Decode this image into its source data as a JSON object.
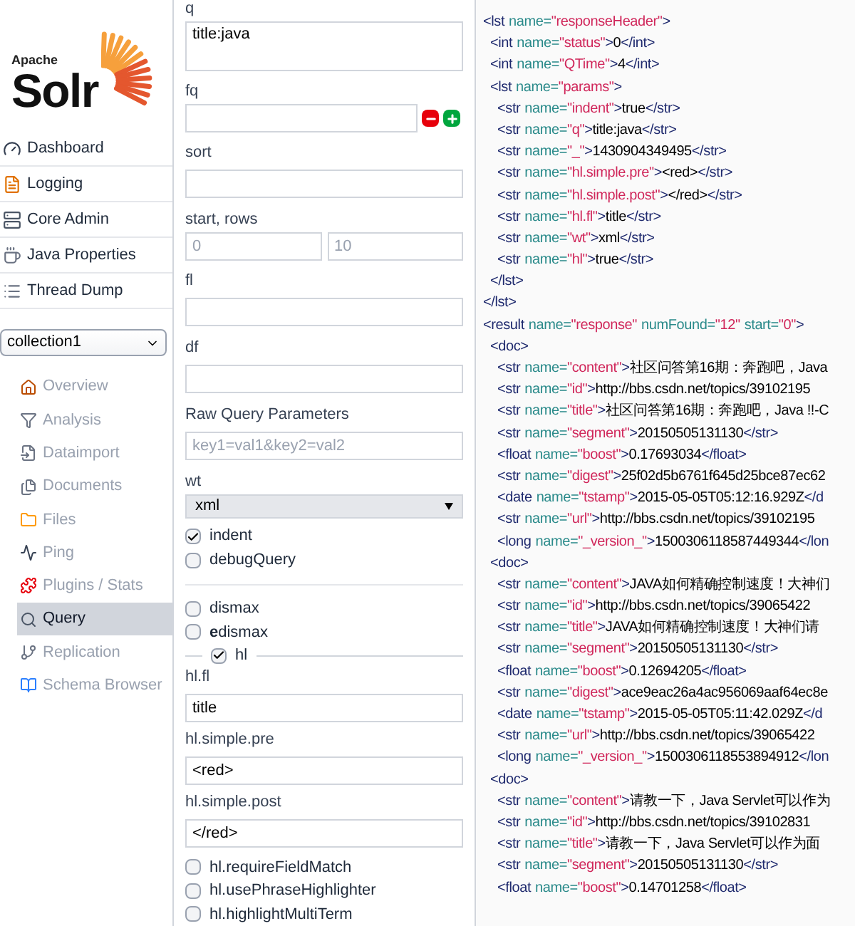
{
  "logo": {
    "small": "Apache",
    "big": "Solr"
  },
  "nav": [
    {
      "label": "Dashboard"
    },
    {
      "label": "Logging"
    },
    {
      "label": "Core Admin"
    },
    {
      "label": "Java Properties"
    },
    {
      "label": "Thread Dump"
    }
  ],
  "core_select": {
    "value": "collection1"
  },
  "core_menu": [
    {
      "label": "Overview",
      "selected": false
    },
    {
      "label": "Analysis",
      "selected": false
    },
    {
      "label": "Dataimport",
      "selected": false
    },
    {
      "label": "Documents",
      "selected": false
    },
    {
      "label": "Files",
      "selected": false
    },
    {
      "label": "Ping",
      "selected": false
    },
    {
      "label": "Plugins / Stats",
      "selected": false
    },
    {
      "label": "Query",
      "selected": true
    },
    {
      "label": "Replication",
      "selected": false
    },
    {
      "label": "Schema Browser",
      "selected": false
    }
  ],
  "form": [
    {
      "kind": "textarea",
      "label": "q",
      "value": "title:java"
    },
    {
      "kind": "filter",
      "label": "fq"
    },
    {
      "kind": "text",
      "label": "sort"
    },
    {
      "kind": "pair",
      "label": "start, rows",
      "placeholders": [
        "0",
        "10"
      ]
    },
    {
      "kind": "text",
      "label": "fl"
    },
    {
      "kind": "text",
      "label": "df"
    },
    {
      "kind": "text",
      "label": "Raw Query Parameters",
      "placeholder": "key1=val1&key2=val2"
    },
    {
      "kind": "select",
      "label": "wt",
      "value": "xml"
    },
    {
      "kind": "checkbox",
      "label": "indent",
      "checked": true
    },
    {
      "kind": "checkbox",
      "label": "debugQuery",
      "checked": false
    }
  ],
  "def_types": [
    {
      "label": "dismax",
      "checked": false
    },
    {
      "label": "**e**dismax",
      "checked": false
    }
  ],
  "hl": {
    "label": "hl",
    "checked": true,
    "fields": [
      {
        "label": "hl.fl",
        "value": "title"
      },
      {
        "label": "hl.simple.pre",
        "value": "<red>"
      },
      {
        "label": "hl.simple.post",
        "value": "</red>"
      }
    ],
    "options": [
      {
        "label": "hl.requireFieldMatch",
        "checked": false
      },
      {
        "label": "hl.usePhraseHighlighter",
        "checked": false
      },
      {
        "label": "hl.highlightMultiTerm",
        "checked": false
      }
    ]
  },
  "response": [
    {
      "parts": [
        {
          "kind": "tag",
          "text": "<lst"
        },
        {
          "kind": "attr",
          "text": "name="
        },
        {
          "kind": "value",
          "text": "\"responseHeader\""
        },
        {
          "kind": "tag",
          "text": ">"
        }
      ],
      "children": [
        {
          "parts": [
            {
              "kind": "tag",
              "text": "<int"
            },
            {
              "kind": "attr",
              "text": "name="
            },
            {
              "kind": "value",
              "text": "\"status\""
            },
            {
              "kind": "tag",
              "text": ">"
            },
            {
              "kind": "text",
              "text": "0"
            },
            {
              "kind": "tag",
              "text": "</int>"
            }
          ]
        },
        {
          "parts": [
            {
              "kind": "tag",
              "text": "<int"
            },
            {
              "kind": "attr",
              "text": "name="
            },
            {
              "kind": "value",
              "text": "\"QTime\""
            },
            {
              "kind": "tag",
              "text": ">"
            },
            {
              "kind": "text",
              "text": "4"
            },
            {
              "kind": "tag",
              "text": "</int>"
            }
          ]
        },
        {
          "parts": [
            {
              "kind": "tag",
              "text": "<lst"
            },
            {
              "kind": "attr",
              "text": "name="
            },
            {
              "kind": "value",
              "text": "\"params\""
            },
            {
              "kind": "tag",
              "text": ">"
            }
          ],
          "children": [
            {
              "parts": [
                {
                  "kind": "tag",
                  "text": "<str"
                },
                {
                  "kind": "attr",
                  "text": "name="
                },
                {
                  "kind": "value",
                  "text": "\"indent\""
                },
                {
                  "kind": "tag",
                  "text": ">"
                },
                {
                  "kind": "text",
                  "text": "true"
                },
                {
                  "kind": "tag",
                  "text": "</str>"
                }
              ]
            },
            {
              "parts": [
                {
                  "kind": "tag",
                  "text": "<str"
                },
                {
                  "kind": "attr",
                  "text": "name="
                },
                {
                  "kind": "value",
                  "text": "\"q\""
                },
                {
                  "kind": "tag",
                  "text": ">"
                },
                {
                  "kind": "text",
                  "text": "title:java"
                },
                {
                  "kind": "tag",
                  "text": "</str>"
                }
              ]
            },
            {
              "parts": [
                {
                  "kind": "tag",
                  "text": "<str"
                },
                {
                  "kind": "attr",
                  "text": "name="
                },
                {
                  "kind": "value",
                  "text": "\"_\""
                },
                {
                  "kind": "tag",
                  "text": ">"
                },
                {
                  "kind": "text",
                  "text": "1430904349495"
                },
                {
                  "kind": "tag",
                  "text": "</str>"
                }
              ]
            },
            {
              "parts": [
                {
                  "kind": "tag",
                  "text": "<str"
                },
                {
                  "kind": "attr",
                  "text": "name="
                },
                {
                  "kind": "value",
                  "text": "\"hl.simple.pre\""
                },
                {
                  "kind": "tag",
                  "text": ">"
                },
                {
                  "kind": "text",
                  "text": "<red>"
                },
                {
                  "kind": "tag",
                  "text": "</str>"
                }
              ]
            },
            {
              "parts": [
                {
                  "kind": "tag",
                  "text": "<str"
                },
                {
                  "kind": "attr",
                  "text": "name="
                },
                {
                  "kind": "value",
                  "text": "\"hl.simple.post\""
                },
                {
                  "kind": "tag",
                  "text": ">"
                },
                {
                  "kind": "text",
                  "text": "</red>"
                },
                {
                  "kind": "tag",
                  "text": "</str>"
                }
              ]
            },
            {
              "parts": [
                {
                  "kind": "tag",
                  "text": "<str"
                },
                {
                  "kind": "attr",
                  "text": "name="
                },
                {
                  "kind": "value",
                  "text": "\"hl.fl\""
                },
                {
                  "kind": "tag",
                  "text": ">"
                },
                {
                  "kind": "text",
                  "text": "title"
                },
                {
                  "kind": "tag",
                  "text": "</str>"
                }
              ]
            },
            {
              "parts": [
                {
                  "kind": "tag",
                  "text": "<str"
                },
                {
                  "kind": "attr",
                  "text": "name="
                },
                {
                  "kind": "value",
                  "text": "\"wt\""
                },
                {
                  "kind": "tag",
                  "text": ">"
                },
                {
                  "kind": "text",
                  "text": "xml"
                },
                {
                  "kind": "tag",
                  "text": "</str>"
                }
              ]
            },
            {
              "parts": [
                {
                  "kind": "tag",
                  "text": "<str"
                },
                {
                  "kind": "attr",
                  "text": "name="
                },
                {
                  "kind": "value",
                  "text": "\"hl\""
                },
                {
                  "kind": "tag",
                  "text": ">"
                },
                {
                  "kind": "text",
                  "text": "true"
                },
                {
                  "kind": "tag",
                  "text": "</str>"
                }
              ]
            }
          ],
          "close": [
            {
              "kind": "tag",
              "text": "</lst>"
            }
          ]
        }
      ],
      "close": [
        {
          "kind": "tag",
          "text": "</lst>"
        }
      ]
    },
    {
      "parts": [
        {
          "kind": "tag",
          "text": "<result"
        },
        {
          "kind": "attr",
          "text": "name="
        },
        {
          "kind": "value",
          "text": "\"response\""
        },
        {
          "kind": "attr",
          "text": "numFound="
        },
        {
          "kind": "value",
          "text": "\"12\""
        },
        {
          "kind": "attr",
          "text": "start="
        },
        {
          "kind": "value",
          "text": "\"0\""
        },
        {
          "kind": "tag",
          "text": ">"
        }
      ],
      "children": [
        {
          "parts": [
            {
              "kind": "tag",
              "text": "<doc>"
            }
          ],
          "children": [
            {
              "parts": [
                {
                  "kind": "tag",
                  "text": "<str"
                },
                {
                  "kind": "attr",
                  "text": "name="
                },
                {
                  "kind": "value",
                  "text": "\"content\""
                },
                {
                  "kind": "tag",
                  "text": ">"
                },
                {
                  "kind": "text",
                  "text": "社区问答第16期：奔跑吧，Java"
                }
              ]
            },
            {
              "parts": [
                {
                  "kind": "tag",
                  "text": "<str"
                },
                {
                  "kind": "attr",
                  "text": "name="
                },
                {
                  "kind": "value",
                  "text": "\"id\""
                },
                {
                  "kind": "tag",
                  "text": ">"
                },
                {
                  "kind": "text",
                  "text": "http://bbs.csdn.net/topics/39102195"
                }
              ]
            },
            {
              "parts": [
                {
                  "kind": "tag",
                  "text": "<str"
                },
                {
                  "kind": "attr",
                  "text": "name="
                },
                {
                  "kind": "value",
                  "text": "\"title\""
                },
                {
                  "kind": "tag",
                  "text": ">"
                },
                {
                  "kind": "text",
                  "text": "社区问答第16期：奔跑吧，Java !!-C"
                }
              ]
            },
            {
              "parts": [
                {
                  "kind": "tag",
                  "text": "<str"
                },
                {
                  "kind": "attr",
                  "text": "name="
                },
                {
                  "kind": "value",
                  "text": "\"segment\""
                },
                {
                  "kind": "tag",
                  "text": ">"
                },
                {
                  "kind": "text",
                  "text": "20150505131130"
                },
                {
                  "kind": "tag",
                  "text": "</str>"
                }
              ]
            },
            {
              "parts": [
                {
                  "kind": "tag",
                  "text": "<float"
                },
                {
                  "kind": "attr",
                  "text": "name="
                },
                {
                  "kind": "value",
                  "text": "\"boost\""
                },
                {
                  "kind": "tag",
                  "text": ">"
                },
                {
                  "kind": "text",
                  "text": "0.17693034"
                },
                {
                  "kind": "tag",
                  "text": "</float>"
                }
              ]
            },
            {
              "parts": [
                {
                  "kind": "tag",
                  "text": "<str"
                },
                {
                  "kind": "attr",
                  "text": "name="
                },
                {
                  "kind": "value",
                  "text": "\"digest\""
                },
                {
                  "kind": "tag",
                  "text": ">"
                },
                {
                  "kind": "text",
                  "text": "25f02d5b6761f645d25bce87ec62"
                }
              ]
            },
            {
              "parts": [
                {
                  "kind": "tag",
                  "text": "<date"
                },
                {
                  "kind": "attr",
                  "text": "name="
                },
                {
                  "kind": "value",
                  "text": "\"tstamp\""
                },
                {
                  "kind": "tag",
                  "text": ">"
                },
                {
                  "kind": "text",
                  "text": "2015-05-05T05:12:16.929Z"
                },
                {
                  "kind": "tag",
                  "text": "</d"
                }
              ]
            },
            {
              "parts": [
                {
                  "kind": "tag",
                  "text": "<str"
                },
                {
                  "kind": "attr",
                  "text": "name="
                },
                {
                  "kind": "value",
                  "text": "\"url\""
                },
                {
                  "kind": "tag",
                  "text": ">"
                },
                {
                  "kind": "text",
                  "text": "http://bbs.csdn.net/topics/39102195"
                }
              ]
            },
            {
              "parts": [
                {
                  "kind": "tag",
                  "text": "<long"
                },
                {
                  "kind": "attr",
                  "text": "name="
                },
                {
                  "kind": "value",
                  "text": "\"_version_\""
                },
                {
                  "kind": "tag",
                  "text": ">"
                },
                {
                  "kind": "text",
                  "text": "1500306118587449344"
                },
                {
                  "kind": "tag",
                  "text": "</lon"
                }
              ]
            }
          ]
        },
        {
          "parts": [
            {
              "kind": "tag",
              "text": "<doc>"
            }
          ],
          "children": [
            {
              "parts": [
                {
                  "kind": "tag",
                  "text": "<str"
                },
                {
                  "kind": "attr",
                  "text": "name="
                },
                {
                  "kind": "value",
                  "text": "\"content\""
                },
                {
                  "kind": "tag",
                  "text": ">"
                },
                {
                  "kind": "text",
                  "text": "JAVA如何精确控制速度！大神们"
                }
              ]
            },
            {
              "parts": [
                {
                  "kind": "tag",
                  "text": "<str"
                },
                {
                  "kind": "attr",
                  "text": "name="
                },
                {
                  "kind": "value",
                  "text": "\"id\""
                },
                {
                  "kind": "tag",
                  "text": ">"
                },
                {
                  "kind": "text",
                  "text": "http://bbs.csdn.net/topics/39065422"
                }
              ]
            },
            {
              "parts": [
                {
                  "kind": "tag",
                  "text": "<str"
                },
                {
                  "kind": "attr",
                  "text": "name="
                },
                {
                  "kind": "value",
                  "text": "\"title\""
                },
                {
                  "kind": "tag",
                  "text": ">"
                },
                {
                  "kind": "text",
                  "text": "JAVA如何精确控制速度！大神们请"
                }
              ]
            },
            {
              "parts": [
                {
                  "kind": "tag",
                  "text": "<str"
                },
                {
                  "kind": "attr",
                  "text": "name="
                },
                {
                  "kind": "value",
                  "text": "\"segment\""
                },
                {
                  "kind": "tag",
                  "text": ">"
                },
                {
                  "kind": "text",
                  "text": "20150505131130"
                },
                {
                  "kind": "tag",
                  "text": "</str>"
                }
              ]
            },
            {
              "parts": [
                {
                  "kind": "tag",
                  "text": "<float"
                },
                {
                  "kind": "attr",
                  "text": "name="
                },
                {
                  "kind": "value",
                  "text": "\"boost\""
                },
                {
                  "kind": "tag",
                  "text": ">"
                },
                {
                  "kind": "text",
                  "text": "0.12694205"
                },
                {
                  "kind": "tag",
                  "text": "</float>"
                }
              ]
            },
            {
              "parts": [
                {
                  "kind": "tag",
                  "text": "<str"
                },
                {
                  "kind": "attr",
                  "text": "name="
                },
                {
                  "kind": "value",
                  "text": "\"digest\""
                },
                {
                  "kind": "tag",
                  "text": ">"
                },
                {
                  "kind": "text",
                  "text": "ace9eac26a4ac956069aaf64ec8e"
                }
              ]
            },
            {
              "parts": [
                {
                  "kind": "tag",
                  "text": "<date"
                },
                {
                  "kind": "attr",
                  "text": "name="
                },
                {
                  "kind": "value",
                  "text": "\"tstamp\""
                },
                {
                  "kind": "tag",
                  "text": ">"
                },
                {
                  "kind": "text",
                  "text": "2015-05-05T05:11:42.029Z"
                },
                {
                  "kind": "tag",
                  "text": "</d"
                }
              ]
            },
            {
              "parts": [
                {
                  "kind": "tag",
                  "text": "<str"
                },
                {
                  "kind": "attr",
                  "text": "name="
                },
                {
                  "kind": "value",
                  "text": "\"url\""
                },
                {
                  "kind": "tag",
                  "text": ">"
                },
                {
                  "kind": "text",
                  "text": "http://bbs.csdn.net/topics/39065422"
                }
              ]
            },
            {
              "parts": [
                {
                  "kind": "tag",
                  "text": "<long"
                },
                {
                  "kind": "attr",
                  "text": "name="
                },
                {
                  "kind": "value",
                  "text": "\"_version_\""
                },
                {
                  "kind": "tag",
                  "text": ">"
                },
                {
                  "kind": "text",
                  "text": "1500306118553894912"
                },
                {
                  "kind": "tag",
                  "text": "</lon"
                }
              ]
            }
          ]
        },
        {
          "parts": [
            {
              "kind": "tag",
              "text": "<doc>"
            }
          ],
          "children": [
            {
              "parts": [
                {
                  "kind": "tag",
                  "text": "<str"
                },
                {
                  "kind": "attr",
                  "text": "name="
                },
                {
                  "kind": "value",
                  "text": "\"content\""
                },
                {
                  "kind": "tag",
                  "text": ">"
                },
                {
                  "kind": "text",
                  "text": "请教一下，Java Servlet可以作为"
                }
              ]
            },
            {
              "parts": [
                {
                  "kind": "tag",
                  "text": "<str"
                },
                {
                  "kind": "attr",
                  "text": "name="
                },
                {
                  "kind": "value",
                  "text": "\"id\""
                },
                {
                  "kind": "tag",
                  "text": ">"
                },
                {
                  "kind": "text",
                  "text": "http://bbs.csdn.net/topics/39102831"
                }
              ]
            },
            {
              "parts": [
                {
                  "kind": "tag",
                  "text": "<str"
                },
                {
                  "kind": "attr",
                  "text": "name="
                },
                {
                  "kind": "value",
                  "text": "\"title\""
                },
                {
                  "kind": "tag",
                  "text": ">"
                },
                {
                  "kind": "text",
                  "text": "请教一下，Java Servlet可以作为面"
                }
              ]
            },
            {
              "parts": [
                {
                  "kind": "tag",
                  "text": "<str"
                },
                {
                  "kind": "attr",
                  "text": "name="
                },
                {
                  "kind": "value",
                  "text": "\"segment\""
                },
                {
                  "kind": "tag",
                  "text": ">"
                },
                {
                  "kind": "text",
                  "text": "20150505131130"
                },
                {
                  "kind": "tag",
                  "text": "</str>"
                }
              ]
            },
            {
              "parts": [
                {
                  "kind": "tag",
                  "text": "<float"
                },
                {
                  "kind": "attr",
                  "text": "name="
                },
                {
                  "kind": "value",
                  "text": "\"boost\""
                },
                {
                  "kind": "tag",
                  "text": ">"
                },
                {
                  "kind": "text",
                  "text": "0.14701258"
                },
                {
                  "kind": "tag",
                  "text": "</float>"
                }
              ]
            }
          ]
        }
      ]
    }
  ]
}
